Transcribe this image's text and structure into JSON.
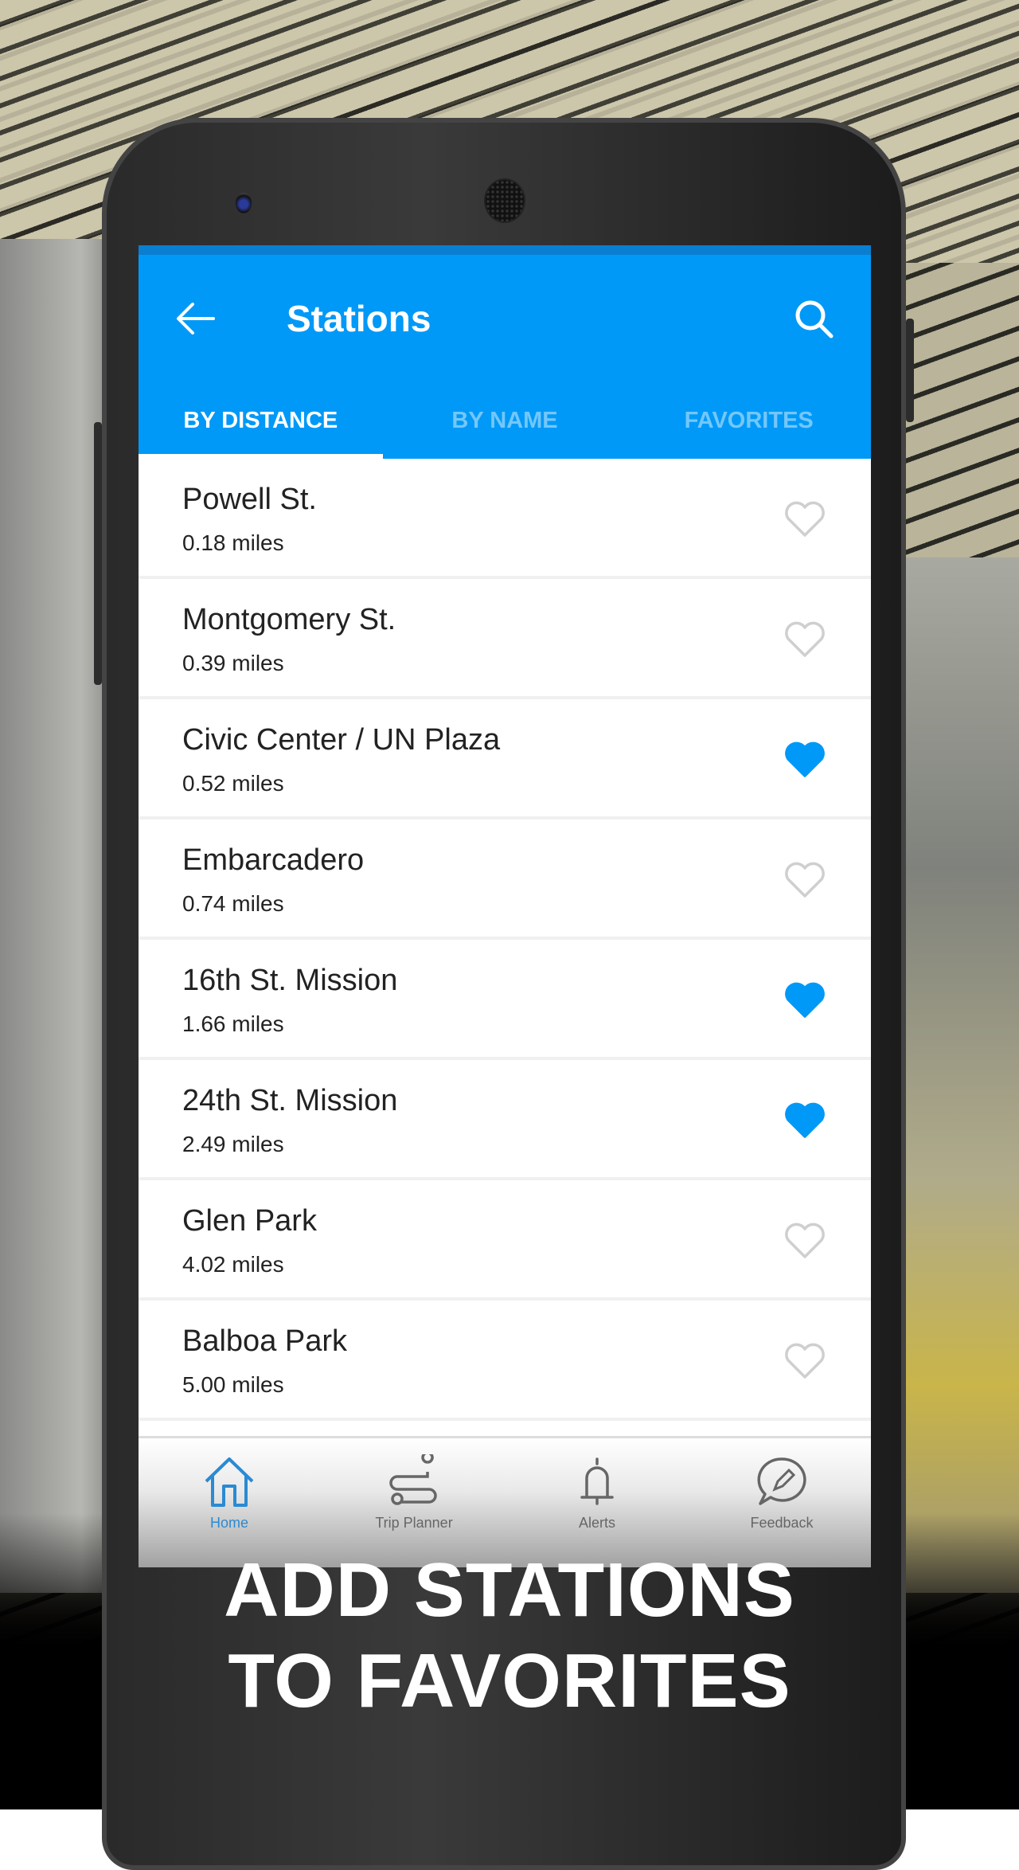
{
  "app": {
    "title": "Stations",
    "accent_color": "#0099f7"
  },
  "header": {
    "back_icon": "arrow-left-icon",
    "search_icon": "search-icon"
  },
  "tabs": [
    {
      "label": "BY DISTANCE",
      "active": true
    },
    {
      "label": "BY NAME",
      "active": false
    },
    {
      "label": "FAVORITES",
      "active": false
    }
  ],
  "stations": [
    {
      "name": "Powell St.",
      "distance": "0.18 miles",
      "favorite": false
    },
    {
      "name": "Montgomery St.",
      "distance": "0.39 miles",
      "favorite": false
    },
    {
      "name": "Civic Center / UN Plaza",
      "distance": "0.52 miles",
      "favorite": true
    },
    {
      "name": "Embarcadero",
      "distance": "0.74 miles",
      "favorite": false
    },
    {
      "name": "16th St. Mission",
      "distance": "1.66 miles",
      "favorite": true
    },
    {
      "name": "24th St. Mission",
      "distance": "2.49 miles",
      "favorite": true
    },
    {
      "name": "Glen Park",
      "distance": "4.02 miles",
      "favorite": false
    },
    {
      "name": "Balboa Park",
      "distance": "5.00 miles",
      "favorite": false
    }
  ],
  "bottom_nav": [
    {
      "label": "Home",
      "icon": "home-icon",
      "active": true
    },
    {
      "label": "Trip Planner",
      "icon": "route-icon",
      "active": false
    },
    {
      "label": "Alerts",
      "icon": "bell-icon",
      "active": false
    },
    {
      "label": "Feedback",
      "icon": "feedback-icon",
      "active": false
    }
  ],
  "caption": {
    "line1": "ADD STATIONS",
    "line2": "TO FAVORITES"
  }
}
